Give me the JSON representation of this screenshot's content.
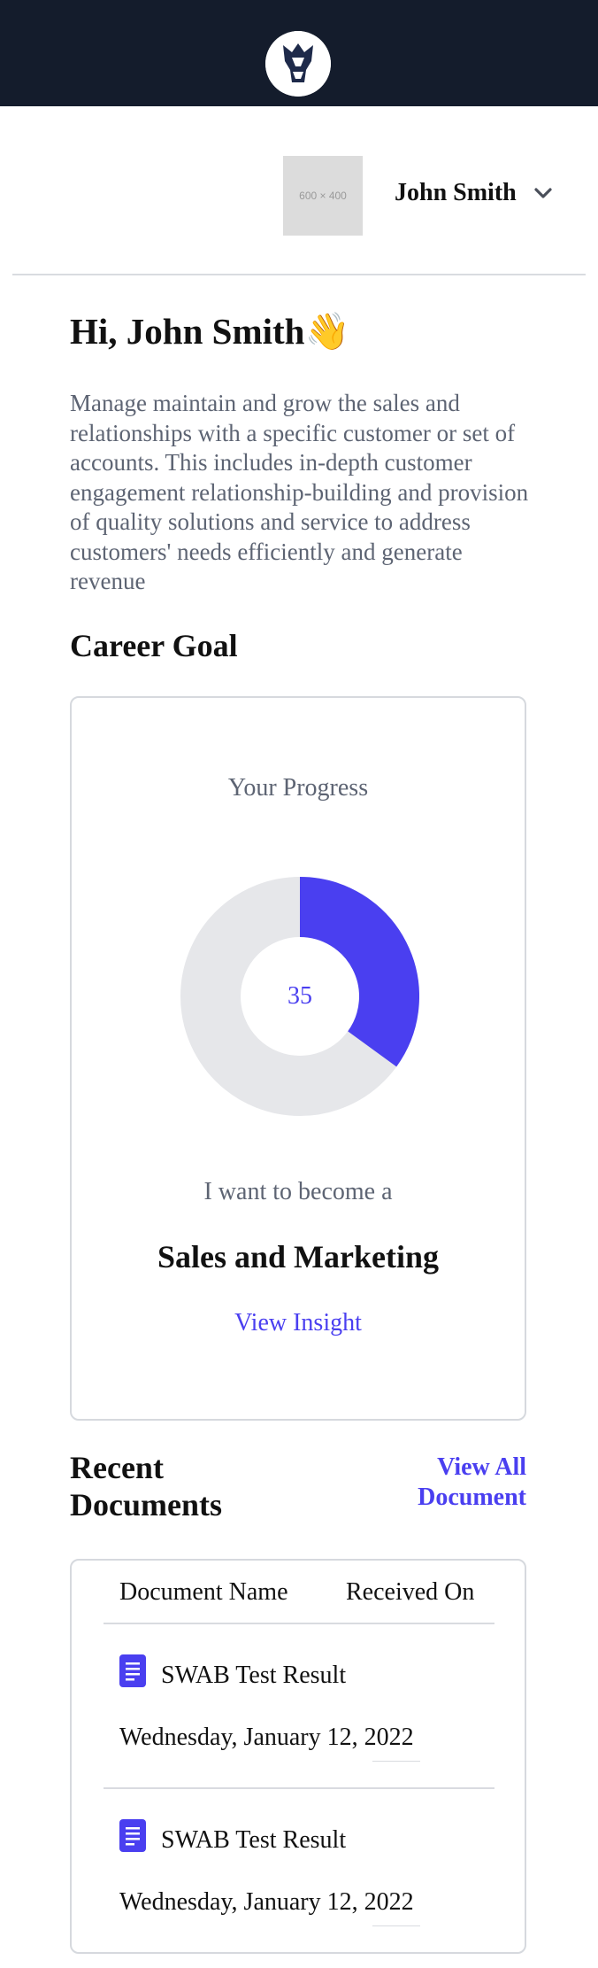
{
  "header": {
    "logo_icon": "lion-logo-icon"
  },
  "user": {
    "avatar_placeholder": "600 × 400",
    "name": "John Smith",
    "chevron_icon": "chevron-down-icon"
  },
  "intro": {
    "greeting": "Hi, John Smith👋",
    "description": "Manage maintain and grow the sales and relationships with a specific customer or set of accounts. This includes in-depth customer engagement relationship-building and provision of quality solutions and service to address customers' needs efficiently and generate revenue"
  },
  "career": {
    "section_title": "Career Goal",
    "progress_label": "Your Progress",
    "progress_value": "35",
    "progress_fraction": 0.35,
    "become_label": "I want to become a",
    "goal": "Sales and Marketing",
    "insight_link": "View Insight"
  },
  "documents": {
    "section_title": "Recent Documents",
    "view_all_label": "View All Document",
    "columns": [
      "Document Name",
      "Received On"
    ],
    "rows": [
      {
        "name": "SWAB Test Result",
        "date": "Wednesday, January 12, 2022",
        "icon": "document-icon"
      },
      {
        "name": "SWAB Test Result",
        "date": "Wednesday, January 12, 2022",
        "icon": "document-icon"
      }
    ]
  },
  "colors": {
    "topbar": "#141c2c",
    "accent": "#4a3ff0",
    "donut_track": "#e6e7ea",
    "muted_text": "#5d6473"
  }
}
